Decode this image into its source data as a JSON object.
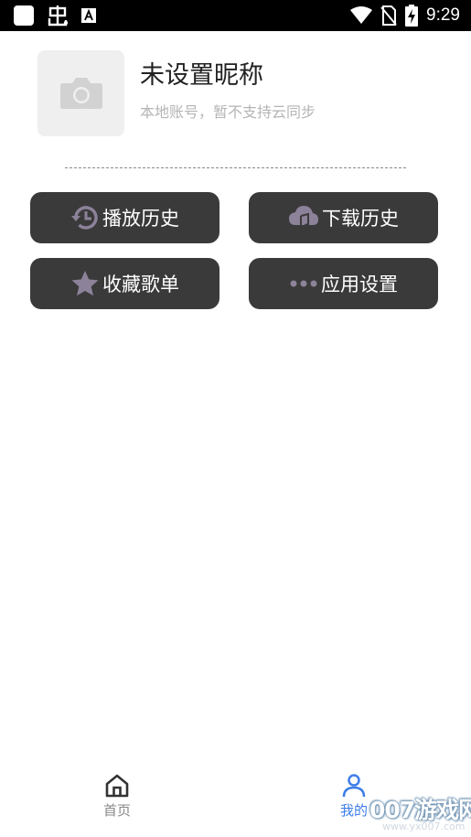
{
  "status_bar": {
    "time": "9:29",
    "left_icons": [
      "app-square-icon",
      "bug-icon",
      "font-a-icon"
    ],
    "right_icons": [
      "wifi-icon",
      "no-sim-icon",
      "battery-charging-icon"
    ]
  },
  "profile": {
    "avatar_icon": "camera-icon",
    "nickname": "未设置昵称",
    "account_note": "本地账号，暂不支持云同步"
  },
  "menu": [
    {
      "label": "播放历史",
      "icon": "history-icon"
    },
    {
      "label": "下载历史",
      "icon": "cloud-music-icon"
    },
    {
      "label": "收藏歌单",
      "icon": "star-icon"
    },
    {
      "label": "应用设置",
      "icon": "more-dots-icon"
    }
  ],
  "bottom_nav": [
    {
      "label": "首页",
      "icon": "home-icon",
      "active": false
    },
    {
      "label": "我的",
      "icon": "person-icon",
      "active": true
    }
  ],
  "watermark": {
    "text": "007游戏网",
    "sub": "www.yx007.com"
  },
  "colors": {
    "button_bg": "#3a3a3a",
    "icon_tint": "#8c8299",
    "active_nav": "#3f7ee8",
    "inactive_nav": "#888888"
  }
}
